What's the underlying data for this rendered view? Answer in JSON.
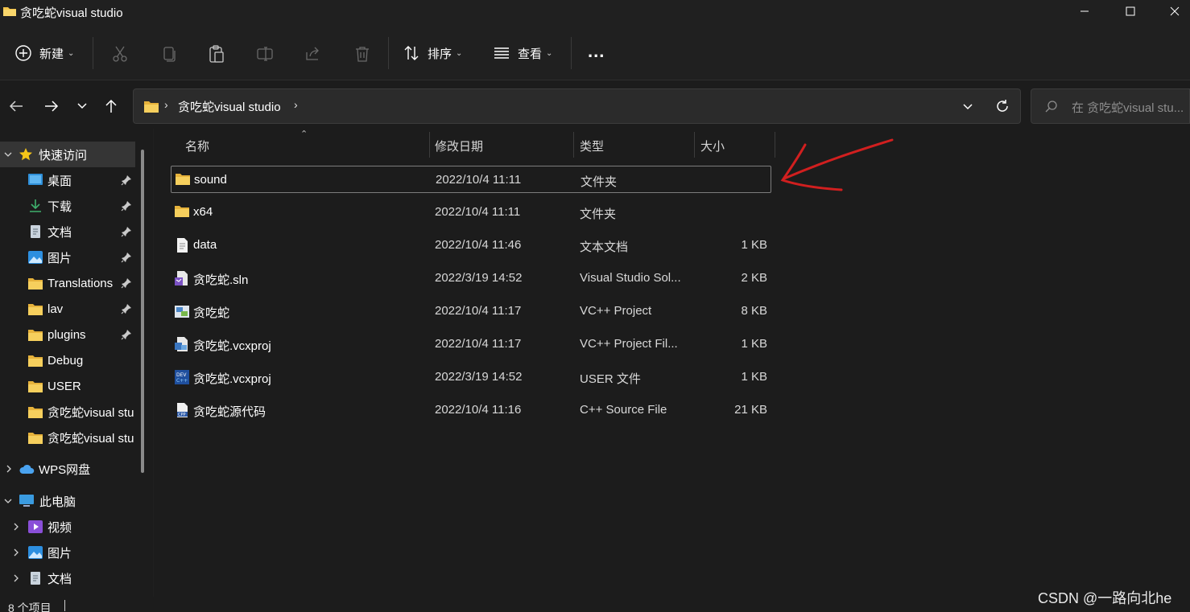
{
  "window": {
    "title": "贪吃蛇visual studio",
    "controls": {
      "minimize": "minimize-icon",
      "maximize": "maximize-icon",
      "close": "close-icon"
    }
  },
  "toolbar": {
    "new_label": "新建",
    "sort_label": "排序",
    "view_label": "查看",
    "more_label": "..."
  },
  "address": {
    "path": "贪吃蛇visual studio",
    "search_placeholder": "在 贪吃蛇visual stu..."
  },
  "sidebar": {
    "quick_access": "快速访问",
    "items": [
      {
        "label": "桌面",
        "icon": "desktop-icon",
        "pinned": true
      },
      {
        "label": "下载",
        "icon": "download-icon",
        "pinned": true
      },
      {
        "label": "文档",
        "icon": "document-icon",
        "pinned": true
      },
      {
        "label": "图片",
        "icon": "picture-icon",
        "pinned": true
      },
      {
        "label": "Translations",
        "icon": "folder-icon",
        "pinned": true
      },
      {
        "label": "lav",
        "icon": "folder-icon",
        "pinned": true
      },
      {
        "label": "plugins",
        "icon": "folder-icon",
        "pinned": true
      },
      {
        "label": "Debug",
        "icon": "folder-icon",
        "pinned": false
      },
      {
        "label": "USER",
        "icon": "folder-icon",
        "pinned": false
      },
      {
        "label": "贪吃蛇visual stu",
        "icon": "folder-icon",
        "pinned": false
      },
      {
        "label": "贪吃蛇visual stu",
        "icon": "folder-icon",
        "pinned": false
      }
    ],
    "wps": "WPS网盘",
    "this_pc": "此电脑",
    "pc_items": [
      {
        "label": "视频",
        "icon": "video-icon"
      },
      {
        "label": "图片",
        "icon": "picture-icon"
      },
      {
        "label": "文档",
        "icon": "document-icon"
      }
    ]
  },
  "columns": {
    "name": "名称",
    "modified": "修改日期",
    "type": "类型",
    "size": "大小"
  },
  "files": [
    {
      "name": "sound",
      "date": "2022/10/4 11:11",
      "type": "文件夹",
      "size": "",
      "icon": "folder-icon"
    },
    {
      "name": "x64",
      "date": "2022/10/4 11:11",
      "type": "文件夹",
      "size": "",
      "icon": "folder-icon"
    },
    {
      "name": "data",
      "date": "2022/10/4 11:46",
      "type": "文本文档",
      "size": "1 KB",
      "icon": "text-file-icon"
    },
    {
      "name": "贪吃蛇.sln",
      "date": "2022/3/19 14:52",
      "type": "Visual Studio Sol...",
      "size": "2 KB",
      "icon": "vs-solution-icon"
    },
    {
      "name": "贪吃蛇",
      "date": "2022/10/4 11:17",
      "type": "VC++ Project",
      "size": "8 KB",
      "icon": "vc-project-icon"
    },
    {
      "name": "贪吃蛇.vcxproj",
      "date": "2022/10/4 11:17",
      "type": "VC++ Project Fil...",
      "size": "1 KB",
      "icon": "vc-filters-icon"
    },
    {
      "name": "贪吃蛇.vcxproj",
      "date": "2022/3/19 14:52",
      "type": "USER 文件",
      "size": "1 KB",
      "icon": "dev-user-icon"
    },
    {
      "name": "贪吃蛇源代码",
      "date": "2022/10/4 11:16",
      "type": "C++ Source File",
      "size": "21 KB",
      "icon": "cpp-file-icon"
    }
  ],
  "status": {
    "item_count": "8 个项目"
  },
  "watermark": "CSDN @一路向北he",
  "colors": {
    "annotation_arrow": "#d11f1f",
    "folder": "#f3c44b"
  }
}
